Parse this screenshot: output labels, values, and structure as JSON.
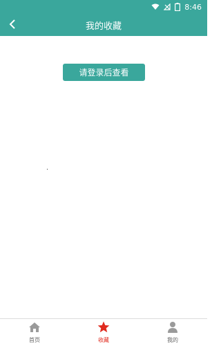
{
  "status_bar": {
    "time": "8:46",
    "battery_glyph": "8"
  },
  "header": {
    "title": "我的收藏"
  },
  "main": {
    "login_button_label": "请登录后查看"
  },
  "tab_bar": {
    "tabs": [
      {
        "label": "首页",
        "icon": "home-icon",
        "active": false
      },
      {
        "label": "收藏",
        "icon": "star-icon",
        "active": true
      },
      {
        "label": "我的",
        "icon": "user-icon",
        "active": false
      }
    ]
  },
  "colors": {
    "primary": "#3aa79c",
    "active_tab": "#e02b1f",
    "inactive_tab": "#999999"
  }
}
